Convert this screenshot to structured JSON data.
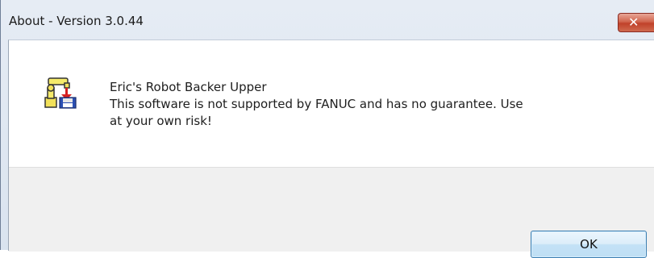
{
  "window": {
    "title": "About - Version 3.0.44",
    "close_label": "✕"
  },
  "message": {
    "app_name": "Eric's Robot Backer Upper",
    "disclaimer_line1": "This software is not supported by FANUC and has no guarantee. Use",
    "disclaimer_line2": "at your own risk!"
  },
  "buttons": {
    "ok_label": "OK"
  },
  "icons": {
    "app": "robot-backup-icon",
    "close": "close-icon"
  },
  "colors": {
    "close_button": "#c0412a",
    "ok_button_border": "#3c7fb1",
    "footer_bg": "#f0f0f0"
  }
}
